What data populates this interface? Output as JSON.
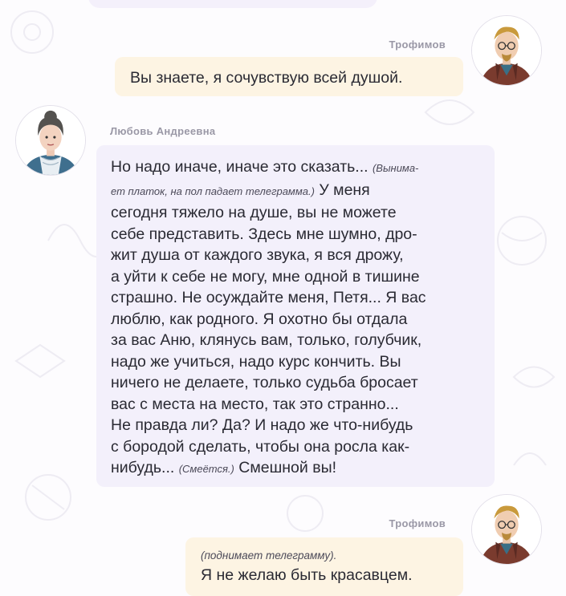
{
  "messages": [
    {
      "speaker": "Трофимов",
      "side": "right",
      "text": "Вы знаете, я сочувствую всей душой."
    },
    {
      "speaker": "Любовь Андреевна",
      "side": "left",
      "lines": [
        [
          "Но надо иначе, иначе это сказать... ",
          {
            "remark": "(Вынима-"
          }
        ],
        [
          {
            "remark": "ет платок, на пол падает телеграмма.)"
          },
          " У меня"
        ],
        [
          "сегодня тяжело на душе, вы не можете"
        ],
        [
          "себе представить. Здесь мне шумно, дро-"
        ],
        [
          "жит душа от каждого звука, я вся дрожу,"
        ],
        [
          "а уйти к себе не могу, мне одной в тишине"
        ],
        [
          "страшно. Не осуждайте меня, Петя... Я вас"
        ],
        [
          "люблю, как родного. Я охотно бы отдала"
        ],
        [
          "за вас Аню, клянусь вам, только, голубчик,"
        ],
        [
          "надо же учиться, надо курс кончить. Вы"
        ],
        [
          "ничего не делаете, только судьба бросает"
        ],
        [
          "вас с места на место, так это странно..."
        ],
        [
          "Не правда ли? Да? И надо же что-нибудь"
        ],
        [
          "с бородой сделать, чтобы она росла как-"
        ],
        [
          "нибудь... ",
          {
            "remark": "(Смеётся.)"
          },
          " Смешной вы!"
        ]
      ]
    },
    {
      "speaker": "Трофимов",
      "side": "right",
      "remark": "(поднимает телеграмму).",
      "text": "Я не желаю быть красавцем."
    }
  ],
  "colors": {
    "right_bubble": "#fdf4e3",
    "left_bubble": "#f3f0fb",
    "speaker_name": "#9a98a6",
    "text": "#2a2a33"
  },
  "icons": [
    "trofimov-avatar",
    "lyubov-andreevna-avatar"
  ]
}
